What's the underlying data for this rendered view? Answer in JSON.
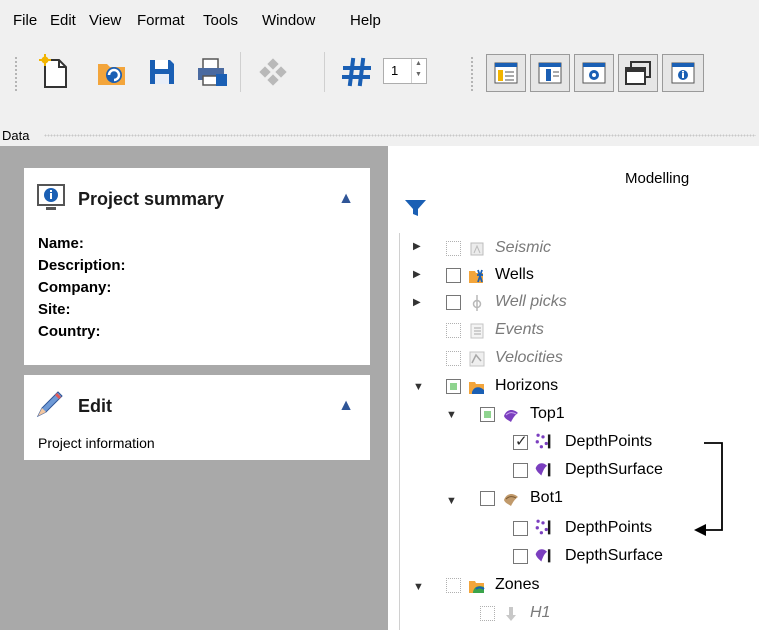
{
  "menu": {
    "file": "File",
    "edit": "Edit",
    "view": "View",
    "format": "Format",
    "tools": "Tools",
    "window": "Window",
    "help": "Help"
  },
  "toolbar": {
    "counter_value": "1"
  },
  "data_label": "Data",
  "project_summary": {
    "title": "Project summary",
    "fields": [
      "Name:",
      "Description:",
      "Company:",
      "Site:",
      "Country:"
    ]
  },
  "edit_card": {
    "title": "Edit",
    "link": "Project information"
  },
  "modelling_label": "Modelling",
  "tree": {
    "seismic": "Seismic",
    "wells": "Wells",
    "well_picks": "Well picks",
    "events": "Events",
    "velocities": "Velocities",
    "horizons": "Horizons",
    "top1": "Top1",
    "top1_points": "DepthPoints",
    "top1_surface": "DepthSurface",
    "bot1": "Bot1",
    "bot1_points": "DepthPoints",
    "bot1_surface": "DepthSurface",
    "zones": "Zones",
    "h1": "H1"
  },
  "colors": {
    "panel_gray": "#a9a9a9",
    "accent_blue": "#1a5fb4",
    "horizon_purple": "#7b3fbf"
  }
}
